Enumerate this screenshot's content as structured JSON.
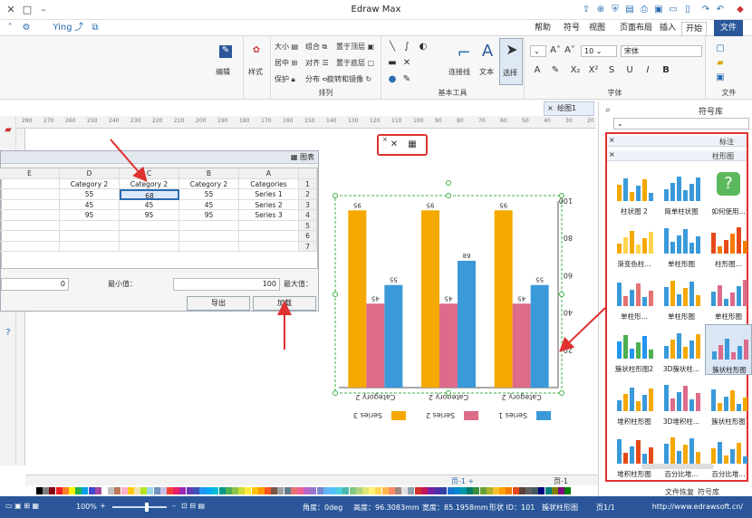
{
  "app": {
    "title": "Edraw Max",
    "user": "Ying"
  },
  "menu": {
    "file": "文件",
    "start": "开始",
    "insert": "插入",
    "page_layout": "页面布局",
    "view": "视图",
    "symbol": "符号",
    "help": "帮助"
  },
  "ribbon": {
    "groups": {
      "file": "文件",
      "font": "字体",
      "basic_tools": "基本工具",
      "arrange": "排列"
    },
    "font_name": "宋体",
    "font_size": "10",
    "select": "选择",
    "text": "文本",
    "connector": "连接线",
    "bring_front": "置于顶层",
    "send_back": "置于底层",
    "rotate_mirror": "旋转和镜像",
    "group": "组合",
    "align": "对齐",
    "distribute": "分布",
    "size": "大小",
    "center": "居中",
    "protect": "保护",
    "style": "样式",
    "edit": "编辑"
  },
  "doc_tab": "绘图1",
  "ruler": [
    "280",
    "270",
    "260",
    "250",
    "240",
    "230",
    "220",
    "210",
    "200",
    "190",
    "180",
    "170",
    "160",
    "150",
    "140",
    "130",
    "120",
    "110",
    "100",
    "90",
    "80",
    "70",
    "60",
    "50",
    "40",
    "30",
    "20"
  ],
  "chart_data": {
    "type": "bar",
    "categories": [
      "Category 2",
      "Category 2",
      "Category 2"
    ],
    "series": [
      {
        "name": "Series 1",
        "color": "#3a9ad9",
        "values": [
          55,
          68,
          55
        ]
      },
      {
        "name": "Series 2",
        "color": "#dd6b8a",
        "values": [
          45,
          45,
          45
        ]
      },
      {
        "name": "Series 3",
        "color": "#f5a800",
        "values": [
          95,
          95,
          95
        ]
      }
    ],
    "data_labels": {
      "series1": [
        "55",
        "68",
        "55"
      ],
      "series2": [
        "45",
        "45",
        "45"
      ],
      "series3": [
        "95",
        "95",
        "95"
      ]
    },
    "yticks": [
      "100",
      "80",
      "60",
      "40",
      "20"
    ],
    "ylim": [
      0,
      100
    ],
    "legend": [
      "Series 1",
      "Series 2",
      "Series 3"
    ],
    "legend_position": "bottom"
  },
  "chart_panel": {
    "title": "图表",
    "col_headers": [
      "A",
      "B",
      "C",
      "D",
      "E"
    ],
    "row_numbers": [
      "1",
      "2",
      "3",
      "4",
      "5",
      "6",
      "7"
    ],
    "rows": [
      [
        "Categories",
        "Category 2",
        "Category 2",
        "Category 2",
        ""
      ],
      [
        "Series 1",
        "55",
        "68",
        "55",
        ""
      ],
      [
        "Series 2",
        "45",
        "45",
        "45",
        ""
      ],
      [
        "Series 3",
        "95",
        "95",
        "95",
        ""
      ]
    ],
    "max_label": "最大值：",
    "max_value": "100",
    "min_label": "最小值：",
    "min_value": "0",
    "import_label": "导出",
    "load_label": "加载"
  },
  "library": {
    "title": "符号库",
    "section_marks": "标注",
    "section_bars": "柱形图",
    "items": [
      "如何使用...",
      "简单柱状图",
      "柱状图 2",
      "柱形图...",
      "单柱形图",
      "渐变色柱...",
      "单柱形图",
      "单柱形图",
      "单柱形...",
      "簇状柱形图",
      "3D簇状柱...",
      "簇状柱形图2",
      "簇状柱形图",
      "3D堆积柱...",
      "堆积柱形图",
      "百分比堆...",
      "百分比堆...",
      "堆积柱形图"
    ],
    "bottom_tabs": [
      "符号库",
      "文件恢复"
    ]
  },
  "page_tab": "页-1",
  "status": {
    "url": "http://www.edrawsoft.cn/",
    "page": "页1/1",
    "shape": "簇状柱形图",
    "shape_id_label": "形状 ID：101",
    "width": "宽度：85.1958mm",
    "height": "高度：96.3083mm",
    "angle": "角度：0deg",
    "zoom": "100%"
  },
  "palette_colors": [
    "#000000",
    "#7f7f7f",
    "#880015",
    "#ed1c24",
    "#ff7f27",
    "#fff200",
    "#22b14c",
    "#00a2e8",
    "#3f48cc",
    "#a349a4",
    "#ffffff",
    "#c3c3c3",
    "#b97a57",
    "#ffaec9",
    "#ffc90e",
    "#efe4b0",
    "#b5e61d",
    "#99d9ea",
    "#7092be",
    "#c8bfe7",
    "#f44336",
    "#e91e63",
    "#9c27b0",
    "#673ab7",
    "#3f51b5",
    "#2196f3",
    "#03a9f4",
    "#00bcd4",
    "#009688",
    "#4caf50",
    "#8bc34a",
    "#cddc39",
    "#ffeb3b",
    "#ffc107",
    "#ff9800",
    "#ff5722",
    "#795548",
    "#9e9e9e",
    "#607d8b",
    "#e57373",
    "#f06292",
    "#ba68c8",
    "#9575cd",
    "#7986cb",
    "#64b5f6",
    "#4fc3f7",
    "#4dd0e1",
    "#4db6ac",
    "#81c784",
    "#aed581",
    "#dce775",
    "#fff176",
    "#ffd54f",
    "#ffb74d",
    "#ff8a65",
    "#a1887f",
    "#e0e0e0",
    "#90a4ae",
    "#d32f2f",
    "#c2185b",
    "#7b1fa2",
    "#512da8",
    "#303f9f",
    "#1976d2",
    "#0288d1",
    "#0097a7",
    "#00796b",
    "#388e3c",
    "#689f38",
    "#afb42b",
    "#fbc02d",
    "#ffa000",
    "#f57c00",
    "#e64a19",
    "#5d4037",
    "#616161",
    "#455a64",
    "#000080",
    "#008080",
    "#808000",
    "#800080",
    "#008000"
  ]
}
